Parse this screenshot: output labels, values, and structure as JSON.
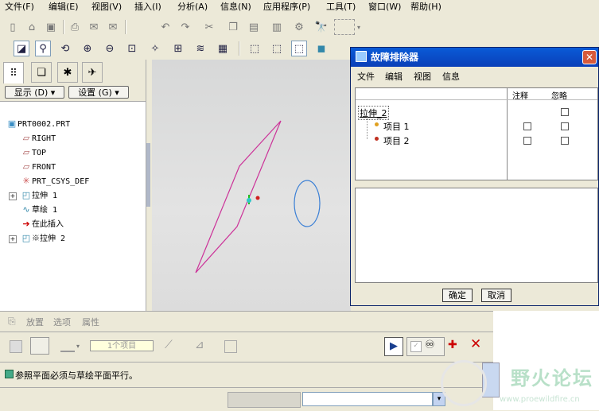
{
  "menubar": {
    "items": [
      "文件(F)",
      "编辑(E)",
      "视图(V)",
      "插入(I)",
      "分析(A)",
      "信息(N)",
      "应用程序(P)",
      "工具(T)",
      "窗口(W)",
      "帮助(H)"
    ]
  },
  "icons": {
    "toolbar1": [
      "new-icon",
      "open-icon",
      "save-icon",
      "print-icon",
      "email-icon",
      "email-attach-icon",
      "undo-icon",
      "redo-icon",
      "cut-icon",
      "copy-icon",
      "paste-icon",
      "paste-special-icon",
      "regenerate-icon",
      "find-icon",
      "select-box-icon"
    ],
    "toolbar2": [
      "redraw-icon",
      "spin-center-icon",
      "orient-icon",
      "zoom-in-icon",
      "zoom-out-icon",
      "refit-icon",
      "reorient-icon",
      "saved-views-icon",
      "layers-icon",
      "view-manager-icon",
      "wireframe-icon",
      "hidden-line-icon",
      "no-hidden-icon",
      "shading-icon"
    ]
  },
  "left_panel": {
    "display_button": "显示 (D) ▾",
    "settings_button": "设置 (G) ▾",
    "tree": [
      {
        "icon": "part-icon",
        "label": "PRT0002.PRT"
      },
      {
        "icon": "datum-plane-icon",
        "label": "RIGHT"
      },
      {
        "icon": "datum-plane-icon",
        "label": "TOP"
      },
      {
        "icon": "datum-plane-icon",
        "label": "FRONT"
      },
      {
        "icon": "csys-icon",
        "label": "PRT_CSYS_DEF"
      },
      {
        "icon": "extrude-icon",
        "label": "拉伸 1"
      },
      {
        "icon": "sketch-icon",
        "label": "草绘 1"
      },
      {
        "icon": "insert-here-icon",
        "label": "在此插入"
      },
      {
        "icon": "extrude-icon",
        "label": "※拉伸 2"
      }
    ]
  },
  "dialog": {
    "title": "故障排除器",
    "menu": [
      "文件",
      "编辑",
      "视图",
      "信息"
    ],
    "col_note": "注释",
    "col_ignore": "忽略",
    "root_item": "拉伸_2",
    "items": [
      "项目 1",
      "项目 2"
    ],
    "ok": "确定",
    "cancel": "取消",
    "colors": {
      "title_bar": "#0a4fc8",
      "item1_dot": "#e0a020",
      "item2_dot": "#c03020"
    }
  },
  "dashboard": {
    "tabs": [
      "放置",
      "选项",
      "属性"
    ],
    "collector_text": "1个项目"
  },
  "message": {
    "text": "参照平面必须与草绘平面平行。"
  },
  "watermark": {
    "text": "野火论坛",
    "url": "www.proewildfire.cn"
  },
  "colors": {
    "accent": "#cc3399",
    "circle": "#3a7fd5",
    "cancel_x": "#cc0000"
  }
}
